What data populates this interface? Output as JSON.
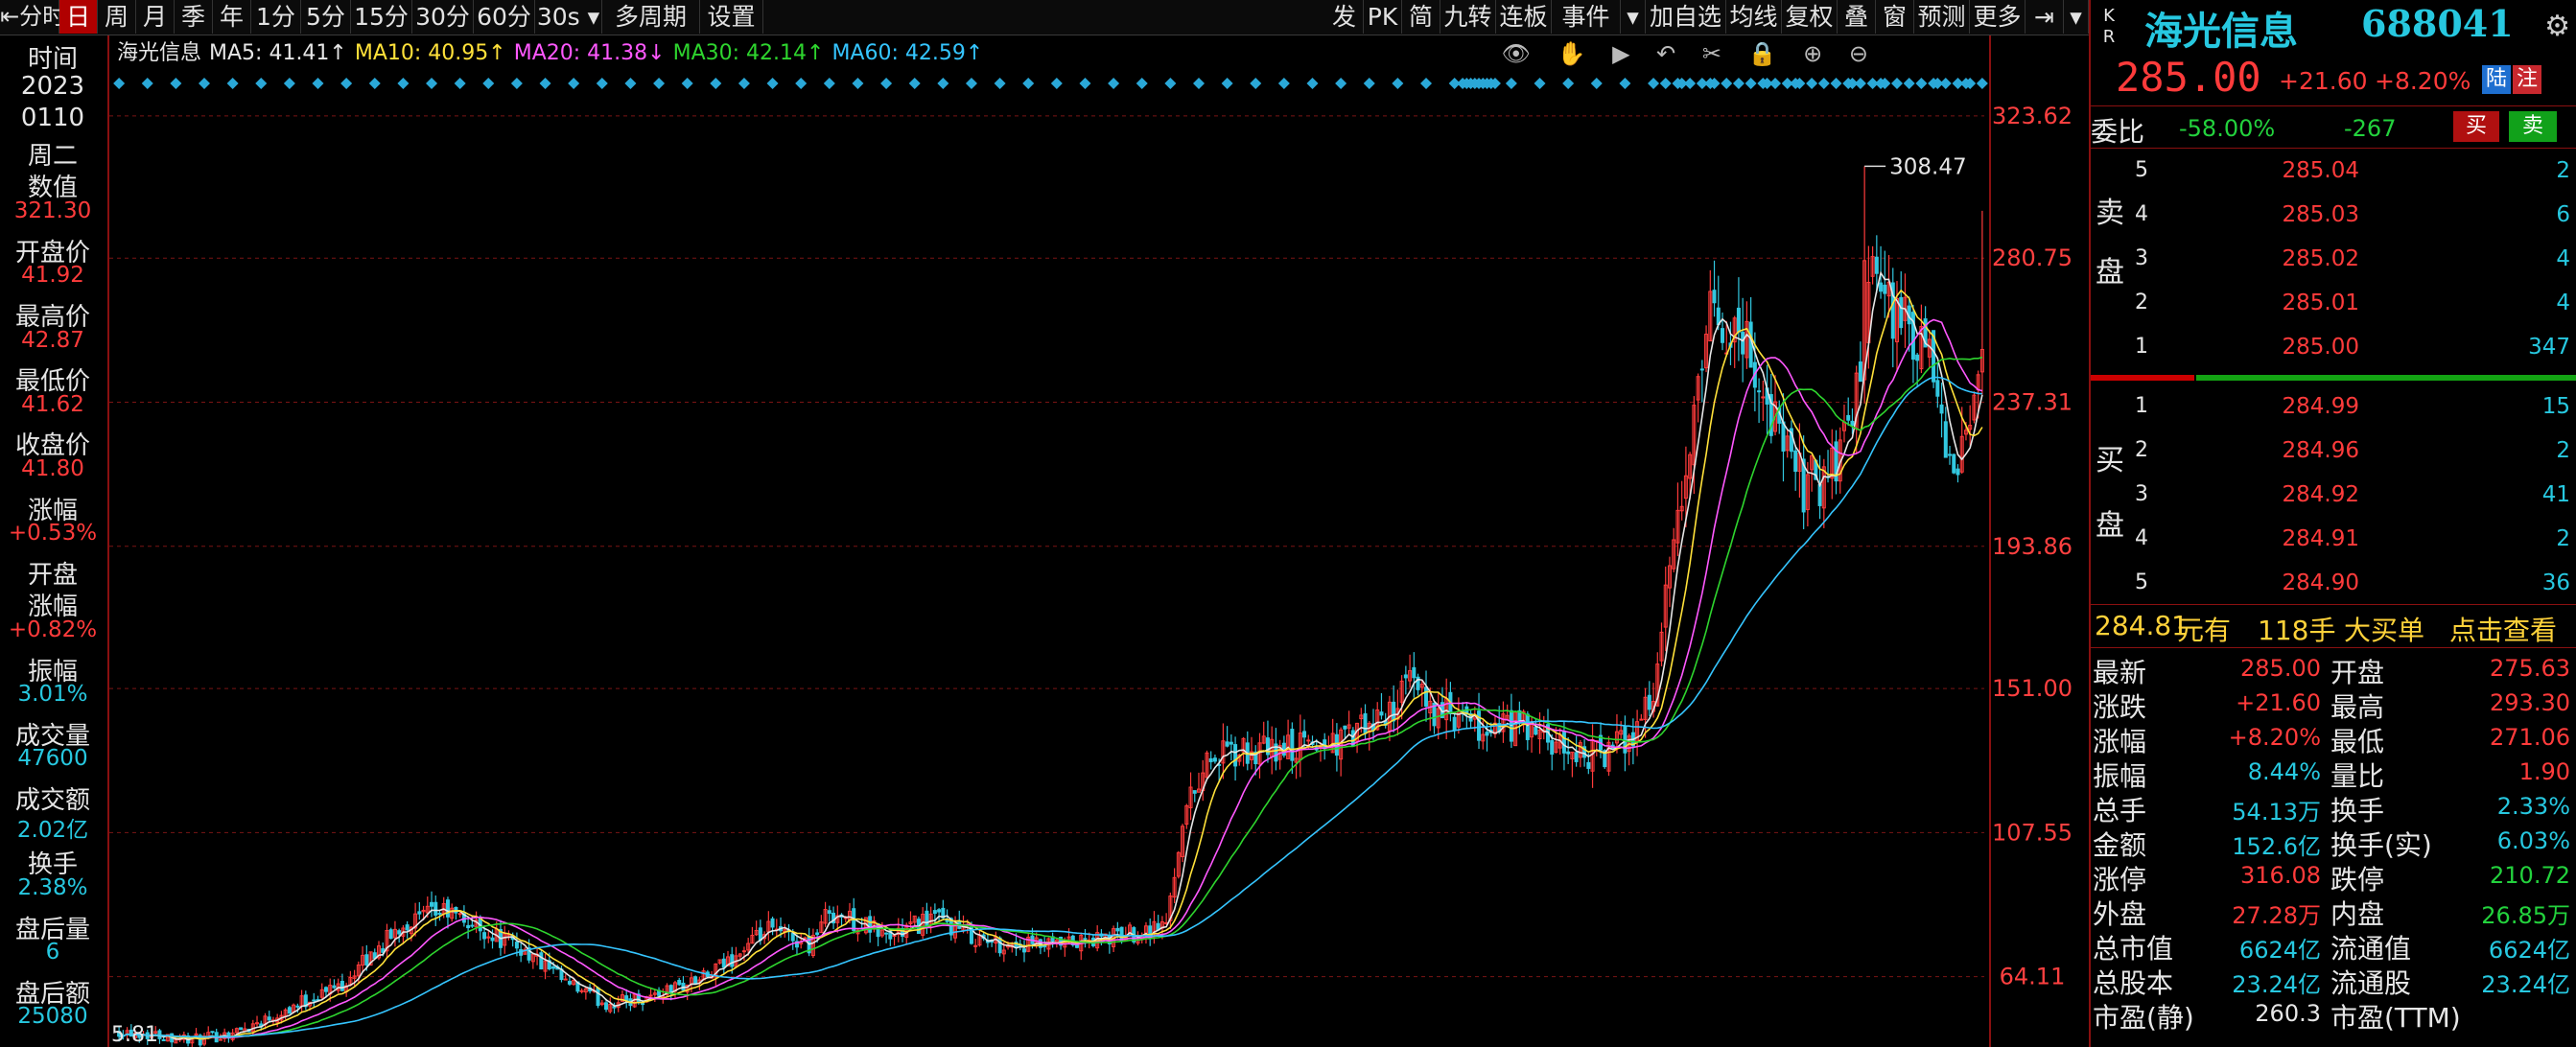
{
  "toolbar": {
    "left_items": [
      {
        "label": "分时",
        "icon": "back-arrow-icon"
      },
      {
        "label": "日",
        "selected": true
      },
      {
        "label": "周"
      },
      {
        "label": "月"
      },
      {
        "label": "季"
      },
      {
        "label": "年"
      },
      {
        "label": "1分"
      },
      {
        "label": "5分"
      },
      {
        "label": "15分"
      },
      {
        "label": "30分"
      },
      {
        "label": "60分"
      },
      {
        "label": "30s",
        "dropdown": true
      },
      {
        "label": "多周期"
      },
      {
        "label": "设置"
      }
    ],
    "right_items": [
      {
        "label": "发"
      },
      {
        "label": "PK"
      },
      {
        "label": "简"
      },
      {
        "label": "九转"
      },
      {
        "label": "连板"
      },
      {
        "label": "事件"
      },
      {
        "label": "▾"
      },
      {
        "label": "加自选"
      },
      {
        "label": "均线"
      },
      {
        "label": "复权"
      },
      {
        "label": "叠"
      },
      {
        "label": "窗"
      },
      {
        "label": "预测"
      },
      {
        "label": "更多"
      },
      {
        "label": "⇥"
      },
      {
        "label": "▾"
      }
    ]
  },
  "left_info": {
    "items": [
      {
        "label": "时间",
        "value": "",
        "color": "#e6e6e6"
      },
      {
        "label": "2023",
        "value": "",
        "color": "#e6e6e6"
      },
      {
        "label": "0110",
        "value": "",
        "color": "#e6e6e6"
      },
      {
        "label": "周二",
        "value": "",
        "color": "#e6e6e6"
      },
      {
        "label": "数值",
        "value": "321.30",
        "color": "#ff3b3b"
      },
      {
        "label": "开盘价",
        "value": "41.92",
        "color": "#ff3b3b"
      },
      {
        "label": "最高价",
        "value": "42.87",
        "color": "#ff3b3b"
      },
      {
        "label": "最低价",
        "value": "41.62",
        "color": "#ff3b3b"
      },
      {
        "label": "收盘价",
        "value": "41.80",
        "color": "#ff3b3b"
      },
      {
        "label": "涨幅",
        "value": "+0.53%",
        "color": "#ff3b3b"
      },
      {
        "label": "开盘\n涨幅",
        "value": "+0.82%",
        "color": "#ff3b3b"
      },
      {
        "label": "振幅",
        "value": "3.01%",
        "color": "#27c8e0"
      },
      {
        "label": "成交量",
        "value": "47600",
        "color": "#27c8e0"
      },
      {
        "label": "成交额",
        "value": "2.02亿",
        "color": "#27c8e0"
      },
      {
        "label": "换手",
        "value": "2.38%",
        "color": "#27c8e0"
      },
      {
        "label": "盘后量",
        "value": "6",
        "color": "#27c8e0"
      },
      {
        "label": "盘后额",
        "value": "25080",
        "color": "#27c8e0"
      }
    ]
  },
  "ma_legend": [
    {
      "label": "海光信息",
      "color": "#e6e6e6"
    },
    {
      "label": "MA5: 41.41↑",
      "color": "#e6e6e6"
    },
    {
      "label": "MA10: 40.95↑",
      "color": "#ffe13a"
    },
    {
      "label": "MA20: 41.38↓",
      "color": "#ff58ff"
    },
    {
      "label": "MA30: 42.14↑",
      "color": "#2ed52e"
    },
    {
      "label": "MA60: 42.59↑",
      "color": "#35c5ff"
    }
  ],
  "chart_tools": "👁 ✋ ▶ ↶ ✂ 🔒 ⊕ ⊖",
  "chart_data": {
    "type": "candlestick",
    "title": "",
    "ylim": [
      45.8,
      334
    ],
    "y_ticks": [
      "323.62",
      "280.75",
      "237.31",
      "193.86",
      "151.00",
      "107.55",
      "64.11"
    ],
    "y_tick_values": [
      323.62,
      280.75,
      237.31,
      193.86,
      151.0,
      107.55,
      64.11
    ],
    "annotations": [
      {
        "text": "308.47",
        "x_index": 430
      },
      {
        "text": "5.81",
        "x_index": 0
      }
    ],
    "n_bars": 460,
    "control_points": [
      [
        0,
        48
      ],
      [
        20,
        45
      ],
      [
        30,
        48
      ],
      [
        55,
        62
      ],
      [
        70,
        80
      ],
      [
        80,
        84
      ],
      [
        90,
        78
      ],
      [
        100,
        72
      ],
      [
        110,
        62
      ],
      [
        120,
        56
      ],
      [
        130,
        58
      ],
      [
        145,
        64
      ],
      [
        160,
        78
      ],
      [
        170,
        74
      ],
      [
        175,
        84
      ],
      [
        190,
        76
      ],
      [
        200,
        82
      ],
      [
        215,
        74
      ],
      [
        230,
        73
      ],
      [
        245,
        76
      ],
      [
        258,
        80
      ],
      [
        262,
        112
      ],
      [
        268,
        130
      ],
      [
        285,
        132
      ],
      [
        300,
        135
      ],
      [
        310,
        140
      ],
      [
        318,
        152
      ],
      [
        325,
        144
      ],
      [
        335,
        138
      ],
      [
        345,
        140
      ],
      [
        355,
        132
      ],
      [
        365,
        131
      ],
      [
        372,
        136
      ],
      [
        378,
        150
      ],
      [
        382,
        185
      ],
      [
        388,
        230
      ],
      [
        392,
        262
      ],
      [
        400,
        258
      ],
      [
        408,
        230
      ],
      [
        415,
        212
      ],
      [
        422,
        216
      ],
      [
        428,
        240
      ],
      [
        432,
        272
      ],
      [
        440,
        260
      ],
      [
        447,
        245
      ],
      [
        452,
        210
      ],
      [
        457,
        240
      ],
      [
        460,
        275
      ]
    ],
    "ma_series": [
      {
        "name": "MA5",
        "color": "#e6e6e6",
        "period": 5
      },
      {
        "name": "MA10",
        "color": "#ffe13a",
        "period": 10
      },
      {
        "name": "MA20",
        "color": "#ff58ff",
        "period": 20
      },
      {
        "name": "MA30",
        "color": "#2ed52e",
        "period": 30
      },
      {
        "name": "MA60",
        "color": "#35c5ff",
        "period": 60
      }
    ],
    "up_color": "#ff3b3b",
    "down_color": "#32c8e0",
    "marker_color": "#2aa8d8"
  },
  "quote": {
    "kr": [
      "K",
      "R"
    ],
    "name": "海光信息",
    "code": "688041",
    "price": "285.00",
    "change": "+21.60",
    "change_pct": "+8.20%",
    "hk_badges": [
      "陆",
      "注"
    ],
    "weibi_label": "委比",
    "weibi_pct": "-58.00%",
    "weibi_num": "-267",
    "buy_label": "买",
    "sell_label": "卖"
  },
  "order_book": {
    "sell_side_label": [
      "卖",
      "盘"
    ],
    "buy_side_label": [
      "买",
      "盘"
    ],
    "asks": [
      {
        "level": "5",
        "price": "285.04",
        "volume": "2"
      },
      {
        "level": "4",
        "price": "285.03",
        "volume": "6"
      },
      {
        "level": "3",
        "price": "285.02",
        "volume": "4"
      },
      {
        "level": "2",
        "price": "285.01",
        "volume": "4"
      },
      {
        "level": "1",
        "price": "285.00",
        "volume": "347"
      }
    ],
    "bids": [
      {
        "level": "1",
        "price": "284.99",
        "volume": "15"
      },
      {
        "level": "2",
        "price": "284.96",
        "volume": "2"
      },
      {
        "level": "3",
        "price": "284.92",
        "volume": "41"
      },
      {
        "level": "4",
        "price": "284.91",
        "volume": "2"
      },
      {
        "level": "5",
        "price": "284.90",
        "volume": "36"
      }
    ]
  },
  "big_order": {
    "price": "284.81",
    "unit1": "元有",
    "qty": "118手",
    "label": "大买单",
    "link": "点击查看"
  },
  "stats": [
    {
      "l1": "最新",
      "v1": "285.00",
      "c1": "r",
      "l2": "开盘",
      "v2": "275.63",
      "c2": "r"
    },
    {
      "l1": "涨跌",
      "v1": "+21.60",
      "c1": "r",
      "l2": "最高",
      "v2": "293.30",
      "c2": "r"
    },
    {
      "l1": "涨幅",
      "v1": "+8.20%",
      "c1": "r",
      "l2": "最低",
      "v2": "271.06",
      "c2": "r"
    },
    {
      "l1": "振幅",
      "v1": "8.44%",
      "c1": "c",
      "l2": "量比",
      "v2": "1.90",
      "c2": "r"
    },
    {
      "l1": "总手",
      "v1": "54.13万",
      "c1": "c",
      "l2": "换手",
      "v2": "2.33%",
      "c2": "c"
    },
    {
      "l1": "金额",
      "v1": "152.6亿",
      "c1": "c",
      "l2": "换手(实)",
      "v2": "6.03%",
      "c2": "c"
    },
    {
      "l1": "涨停",
      "v1": "316.08",
      "c1": "r",
      "l2": "跌停",
      "v2": "210.72",
      "c2": "g"
    },
    {
      "l1": "外盘",
      "v1": "27.28万",
      "c1": "r",
      "l2": "内盘",
      "v2": "26.85万",
      "c2": "g"
    },
    {
      "l1": "总市值",
      "v1": "6624亿",
      "c1": "c",
      "l2": "流通值",
      "v2": "6624亿",
      "c2": "c"
    },
    {
      "l1": "总股本",
      "v1": "23.24亿",
      "c1": "c",
      "l2": "流通股",
      "v2": "23.24亿",
      "c2": "c"
    },
    {
      "l1": "市盈(静)",
      "v1": "260.3",
      "c1": "w",
      "l2": "市盈(TTM)",
      "v2": "",
      "c2": "w"
    }
  ]
}
